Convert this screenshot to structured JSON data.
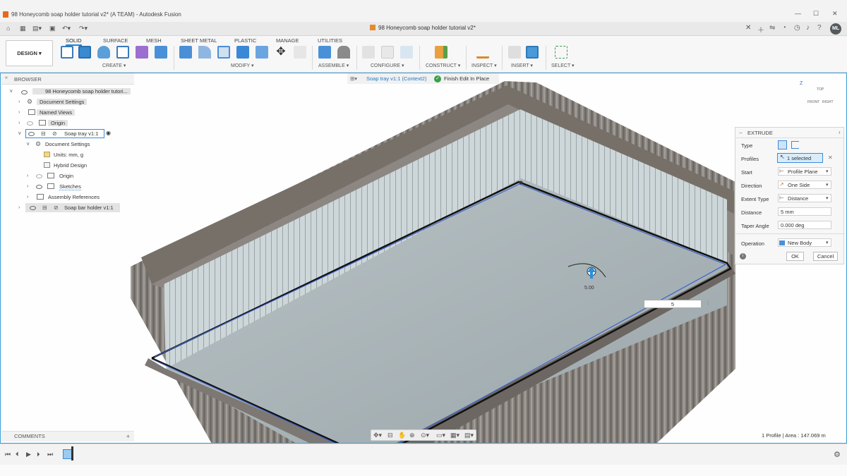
{
  "window": {
    "title": "98 Honeycomb soap holder tutorial v2* (A TEAM) - Autodesk Fusion"
  },
  "tabbar": {
    "doc_tab": "98 Honeycomb soap holder tutorial v2*",
    "avatar": "ML"
  },
  "ribbon": {
    "workspace": "DESIGN",
    "tabs": [
      "SOLID",
      "SURFACE",
      "MESH",
      "SHEET METAL",
      "PLASTIC",
      "MANAGE",
      "UTILITIES"
    ],
    "groups": [
      "CREATE",
      "MODIFY",
      "ASSEMBLE",
      "CONFIGURE",
      "CONSTRUCT",
      "INSPECT",
      "INSERT",
      "SELECT"
    ]
  },
  "browser": {
    "title": "BROWSER",
    "root": "98 Honeycomb soap holder tutori...",
    "items": [
      "Document Settings",
      "Named Views",
      "Origin",
      "Soap tray v1:1",
      "Document Settings",
      "Units: mm, g",
      "Hybrid Design",
      "Origin",
      "Sketches",
      "Assembly References",
      "Soap bar holder v1:1"
    ]
  },
  "context": {
    "component": "Soap tray v1:1 (Context2)",
    "finish": "Finish Edit In Place"
  },
  "extrude": {
    "title": "EXTRUDE",
    "labels": {
      "type": "Type",
      "profiles": "Profiles",
      "start": "Start",
      "direction": "Direction",
      "extent": "Extent Type",
      "distance": "Distance",
      "taper": "Taper Angle",
      "operation": "Operation"
    },
    "values": {
      "profiles": "1 selected",
      "start": "Profile Plane",
      "direction": "One Side",
      "extent": "Distance",
      "distance": "5 mm",
      "taper": "0.000 deg",
      "operation": "New Body"
    },
    "ok": "OK",
    "cancel": "Cancel"
  },
  "viewport": {
    "dim_input": "5",
    "dim_label": "5.00",
    "viewcube": {
      "top": "TOP",
      "front": "FRONT",
      "right": "RIGHT",
      "z": "Z"
    }
  },
  "comments": "COMMENTS",
  "status": "1 Profile | Area : 147.069 m"
}
